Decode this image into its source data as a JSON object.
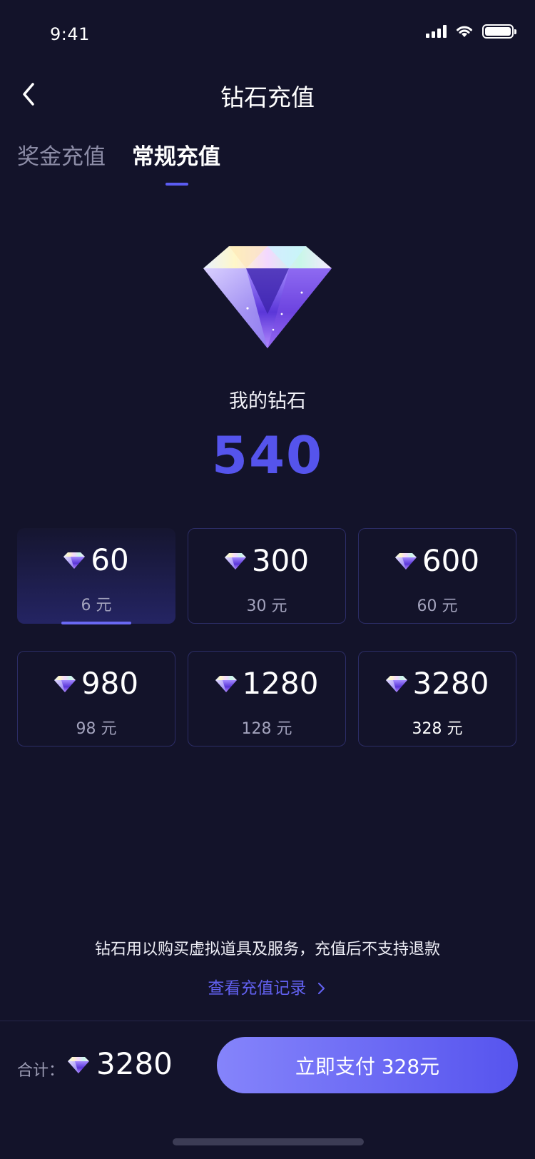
{
  "status_bar": {
    "time": "9:41"
  },
  "header": {
    "title": "钻石充值"
  },
  "tabs": [
    {
      "label": "奖金充值",
      "active": false
    },
    {
      "label": "常规充值",
      "active": true
    }
  ],
  "wallet": {
    "label": "我的钻石",
    "count": "540"
  },
  "packages": [
    {
      "amount": "60",
      "price": "6 元",
      "selected": true
    },
    {
      "amount": "300",
      "price": "30 元",
      "selected": false
    },
    {
      "amount": "600",
      "price": "60 元",
      "selected": false
    },
    {
      "amount": "980",
      "price": "98 元",
      "selected": false
    },
    {
      "amount": "1280",
      "price": "128 元",
      "selected": false
    },
    {
      "amount": "3280",
      "price": "328 元",
      "selected": false
    }
  ],
  "notice": "钻石用以购买虚拟道具及服务，充值后不支持退款",
  "history_link": "查看充值记录",
  "footer": {
    "total_label": "合计：",
    "total_value": "3280",
    "pay_button": "立即支付 328元"
  },
  "colors": {
    "accent": "#5554ec",
    "background": "#13132a"
  },
  "icons": [
    "back-icon",
    "diamond-icon",
    "chevron-right-icon",
    "signal-icon",
    "wifi-icon",
    "battery-icon"
  ]
}
